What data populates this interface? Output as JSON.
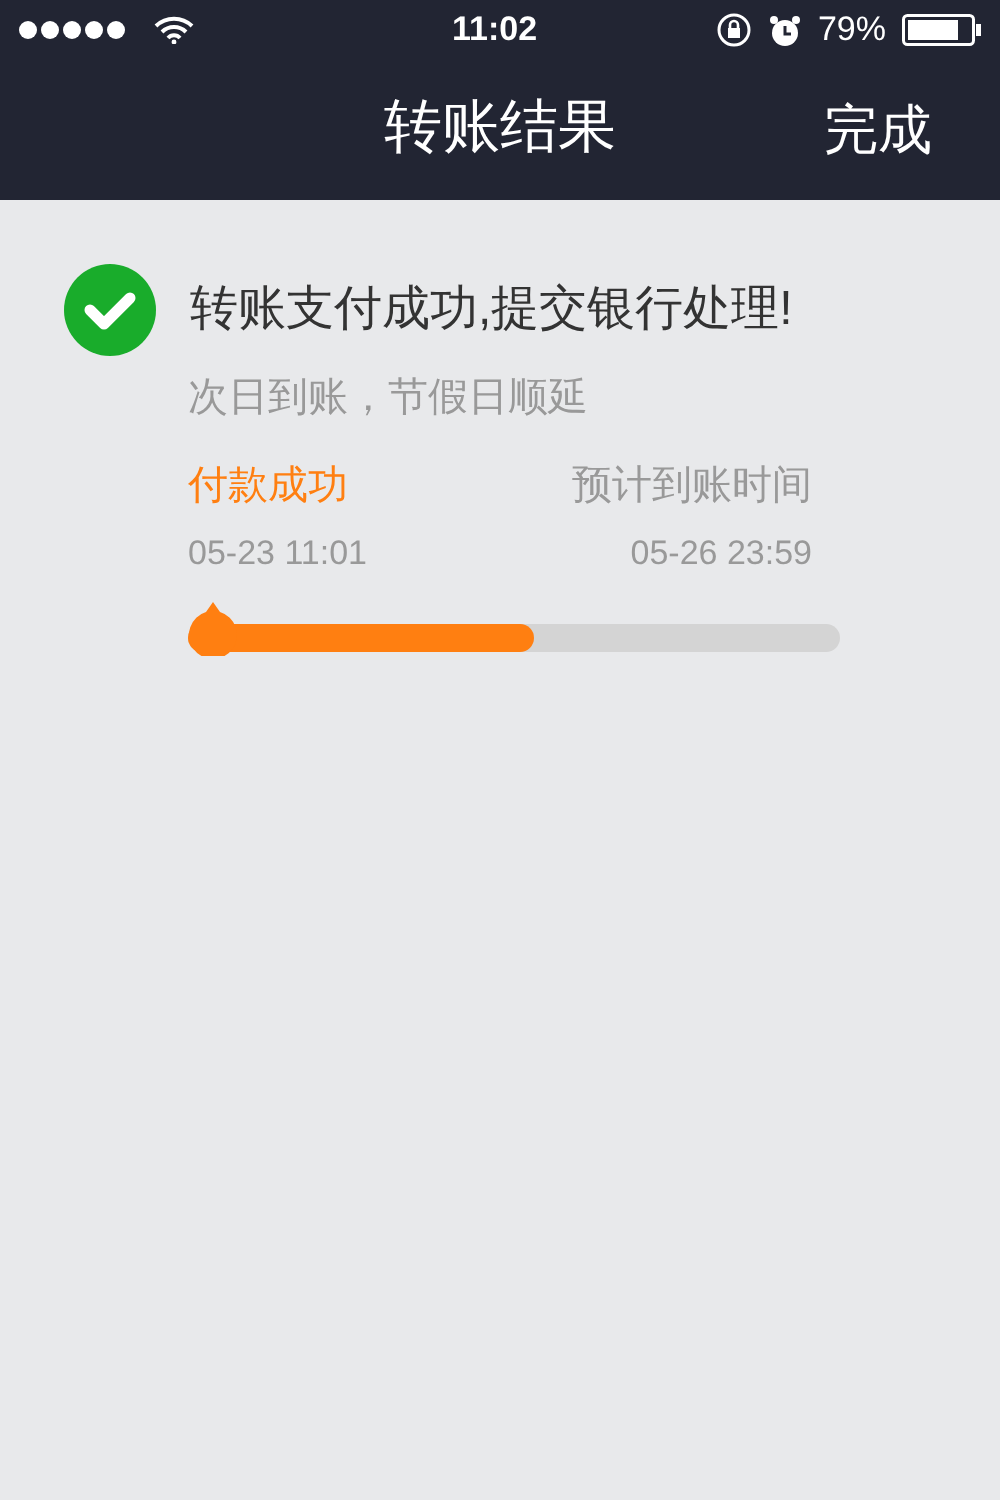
{
  "status_bar": {
    "time": "11:02",
    "battery": "79%"
  },
  "nav": {
    "title": "转账结果",
    "action": "完成"
  },
  "result": {
    "title": "转账支付成功,提交银行处理!",
    "subtitle": "次日到账，节假日顺延"
  },
  "steps": [
    {
      "label": "付款成功",
      "time": "05-23 11:01",
      "done": true
    },
    {
      "label": "预计到账时间",
      "time": "05-26 23:59",
      "done": false
    }
  ],
  "progress": {
    "level": 0.53
  }
}
